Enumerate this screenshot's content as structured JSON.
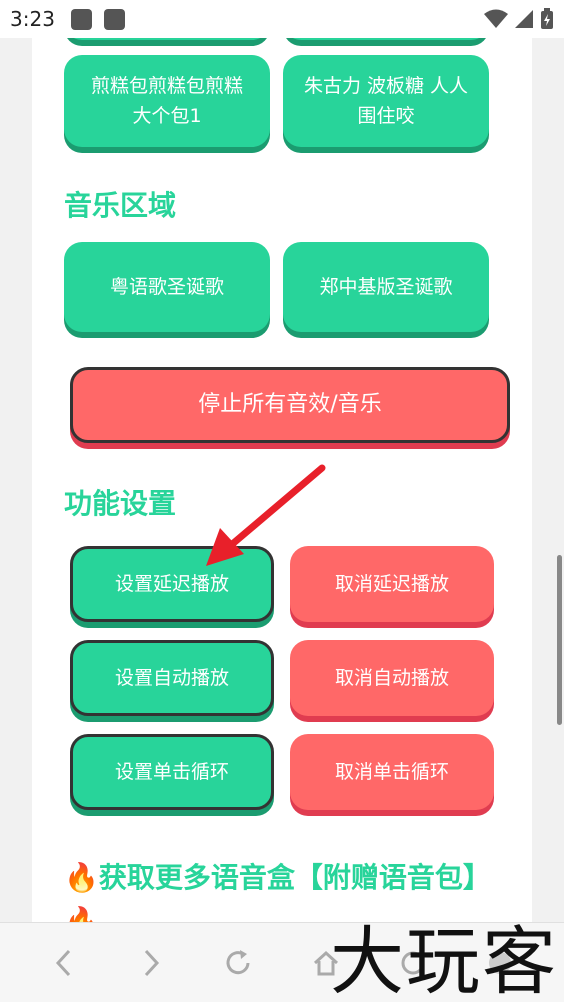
{
  "status_bar": {
    "time": "3:23"
  },
  "sounds": {
    "row_partial": [
      "",
      ""
    ],
    "row1": [
      "煎糕包煎糕包煎糕大个包1",
      "朱古力 波板糖 人人围住咬"
    ]
  },
  "music": {
    "title": "音乐区域",
    "buttons": [
      "粤语歌圣诞歌",
      "郑中基版圣诞歌"
    ]
  },
  "stop_all": "停止所有音效/音乐",
  "settings": {
    "title": "功能设置",
    "rows": [
      [
        "设置延迟播放",
        "取消延迟播放"
      ],
      [
        "设置自动播放",
        "取消自动播放"
      ],
      [
        "设置单击循环",
        "取消单击循环"
      ]
    ]
  },
  "more": {
    "title": "🔥获取更多语音盒【附赠语音包】🔥"
  },
  "watermark": "大玩客",
  "colors": {
    "green": "#28d49a",
    "red": "#ff6868",
    "arrow": "#e8202a"
  }
}
